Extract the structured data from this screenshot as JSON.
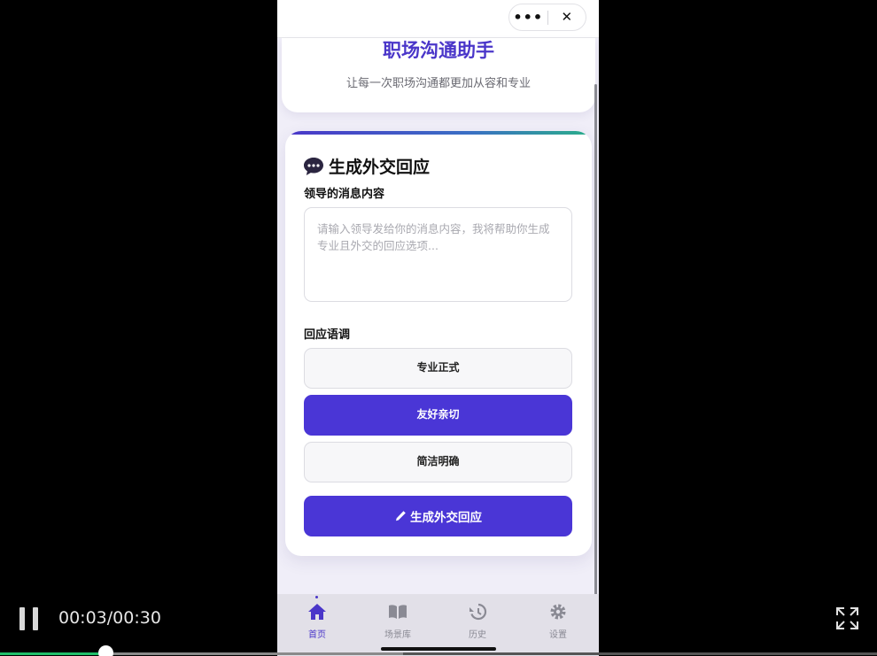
{
  "app": {
    "title": "职场沟通助手",
    "subtitle": "让每一次职场沟通都更加从容和专业"
  },
  "card": {
    "title": "生成外交回应",
    "title_icon": "chat-bubble-icon",
    "message_label": "领导的消息内容",
    "message_placeholder": "请输入领导发给你的消息内容，我将帮助你生成专业且外交的回应选项...",
    "message_value": "",
    "tone_label": "回应语调",
    "tones": [
      {
        "label": "专业正式",
        "selected": false
      },
      {
        "label": "友好亲切",
        "selected": true
      },
      {
        "label": "简洁明确",
        "selected": false
      }
    ],
    "generate_label": "生成外交回应",
    "generate_icon": "pencil-icon"
  },
  "capsule": {
    "more_icon": "more-dots-icon",
    "close_icon": "close-icon"
  },
  "tabbar": {
    "tabs": [
      {
        "label": "首页",
        "icon": "home-icon",
        "active": true
      },
      {
        "label": "场景库",
        "icon": "book-icon",
        "active": false
      },
      {
        "label": "历史",
        "icon": "history-icon",
        "active": false
      },
      {
        "label": "设置",
        "icon": "gear-icon",
        "active": false
      }
    ]
  },
  "video": {
    "time": "00:03/00:30",
    "progress": 0.12,
    "buffered": 0.46,
    "state": "playing",
    "colors": {
      "progress": "#1fbf6a",
      "accent": "#4a36d6"
    }
  }
}
